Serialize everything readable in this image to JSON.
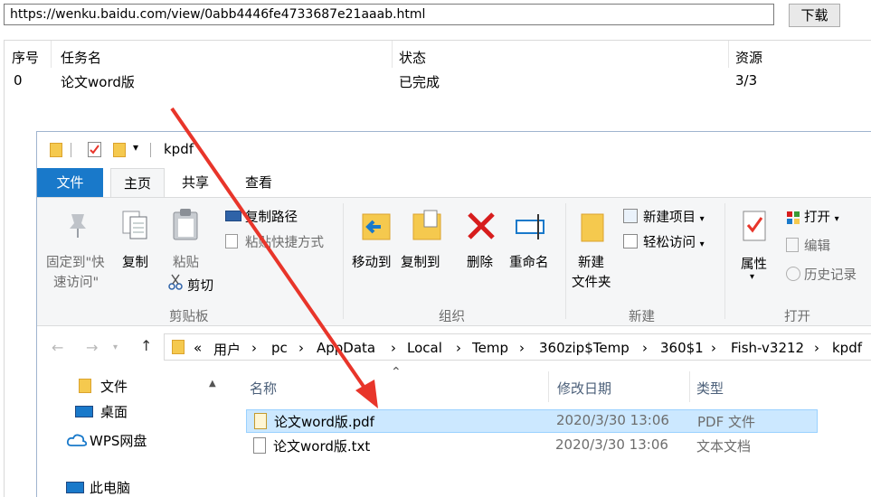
{
  "downloader": {
    "url": "https://wenku.baidu.com/view/0abb4446fe4733687e21aaab.html",
    "download_button": "下载",
    "columns": {
      "index": "序号",
      "task": "任务名",
      "status": "状态",
      "resource": "资源"
    },
    "rows": [
      {
        "index": "0",
        "task": "论文word版",
        "status": "已完成",
        "resource": "3/3"
      }
    ]
  },
  "explorer": {
    "title": "kpdf",
    "tabs": {
      "file": "文件",
      "home": "主页",
      "share": "共享",
      "view": "查看"
    },
    "ribbon": {
      "pin_line1": "固定到\"快",
      "pin_line2": "速访问\"",
      "copy": "复制",
      "paste": "粘贴",
      "copy_path": "复制路径",
      "paste_shortcut": "粘贴快捷方式",
      "cut": "剪切",
      "group_clipboard": "剪贴板",
      "move_to": "移动到",
      "copy_to": "复制到",
      "delete": "删除",
      "rename": "重命名",
      "group_organize": "组织",
      "new_folder_line1": "新建",
      "new_folder_line2": "文件夹",
      "new_item": "新建项目",
      "easy_access": "轻松访问",
      "group_new": "新建",
      "properties": "属性",
      "open": "打开",
      "edit": "编辑",
      "history": "历史记录",
      "group_open": "打开"
    },
    "breadcrumb": {
      "overflow": "«",
      "items": [
        "用户",
        "pc",
        "AppData",
        "Local",
        "Temp",
        "360zip$Temp",
        "360$1",
        "Fish-v3212",
        "kpdf"
      ]
    },
    "nav": {
      "items": [
        "文件",
        "桌面",
        "WPS网盘",
        "此电脑"
      ]
    },
    "columns": {
      "name": "名称",
      "modified": "修改日期",
      "type": "类型"
    },
    "files": [
      {
        "name": "论文word版.pdf",
        "modified": "2020/3/30 13:06",
        "type": "PDF 文件"
      },
      {
        "name": "论文word版.txt",
        "modified": "2020/3/30 13:06",
        "type": "文本文档"
      }
    ]
  },
  "colors": {
    "file_tab": "#1979ca",
    "selection": "#cce8ff",
    "arrow": "#e8352a",
    "folder": "#f5c94e"
  }
}
